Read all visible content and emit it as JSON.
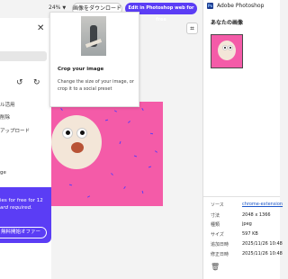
{
  "toolbar": {
    "zoom_level": "24%",
    "download_label": "画像をダウンロード",
    "edit_label": "Edit in Photoshop web for free"
  },
  "left_panel": {
    "items": [
      "ル活用",
      "削除",
      "アップロード",
      "ge"
    ],
    "promo": {
      "line1": "ies for free for 12",
      "line2": "ard required.",
      "button_label": "無料開始オファー"
    }
  },
  "tooltip": {
    "title": "Crop your image",
    "description_line1": "Change the size of your image, or",
    "description_line2": "crop it to a social preset"
  },
  "right_panel": {
    "app_title": "Adobe Photoshop",
    "section_title": "あなたの画像",
    "details": [
      {
        "label": "ソース",
        "value": "chrome-extension",
        "is_link": true
      },
      {
        "label": "寸法",
        "value": "2048 x 1366"
      },
      {
        "label": "種類",
        "value": "jpeg"
      },
      {
        "label": "サイズ",
        "value": "597 KB"
      },
      {
        "label": "追加日時",
        "value": "2025/11/26 10:48"
      },
      {
        "label": "修正日時",
        "value": "2025/11/26 10:48"
      }
    ]
  },
  "colors": {
    "accent": "#5b3df5",
    "photo_background": "#f45ba8"
  },
  "icons": [
    "close-icon",
    "undo-icon",
    "redo-icon",
    "crop-icon",
    "photoshop-logo-icon",
    "trash-icon",
    "chevron-down-icon"
  ]
}
